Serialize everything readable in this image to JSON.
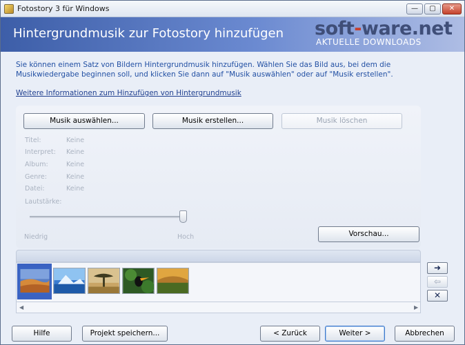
{
  "window": {
    "title": "Fotostory 3 für Windows",
    "controls": {
      "minimize": "—",
      "maximize": "▢",
      "close": "✕"
    }
  },
  "banner": {
    "title": "Hintergrundmusik zur Fotostory hinzufügen",
    "logo_main_1": "soft",
    "logo_dash": "-",
    "logo_main_2": "ware.net",
    "logo_sub": "AKTUELLE DOWNLOADS"
  },
  "description": "Sie können einem Satz von Bildern Hintergrundmusik hinzufügen.  Wählen Sie das Bild aus, bei dem die Musikwiedergabe beginnen soll, und klicken Sie dann auf \"Musik auswählen\" oder auf \"Musik erstellen\".",
  "more_link": "Weitere Informationen zum Hinzufügen von Hintergrundmusik",
  "music_buttons": {
    "select": "Musik auswählen...",
    "create": "Musik erstellen...",
    "delete": "Musik löschen"
  },
  "info": [
    {
      "label": "Titel:",
      "value": "Keine"
    },
    {
      "label": "Interpret:",
      "value": "Keine"
    },
    {
      "label": "Album:",
      "value": "Keine"
    },
    {
      "label": "Genre:",
      "value": "Keine"
    },
    {
      "label": "Datei:",
      "value": "Keine"
    }
  ],
  "volume": {
    "label": "Lautstärke:",
    "low": "Niedrig",
    "high": "Hoch",
    "level": 1.0
  },
  "preview_button": "Vorschau...",
  "filmstrip": {
    "thumbnails": [
      "desert",
      "iceberg",
      "savanna-tree",
      "toucan",
      "landscape"
    ],
    "selected_index": 0
  },
  "side_buttons": {
    "move_right": "➜",
    "move_left": "⇦",
    "remove": "✕"
  },
  "scroll": {
    "left": "◀",
    "right": "▶"
  },
  "footer": {
    "help": "Hilfe",
    "save_project": "Projekt speichern...",
    "back": "< Zurück",
    "next": "Weiter >",
    "cancel": "Abbrechen"
  }
}
